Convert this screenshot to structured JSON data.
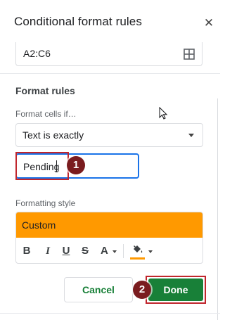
{
  "panel": {
    "title": "Conditional format rules",
    "close_icon": "close-icon",
    "range": "A2:C6",
    "range_icon": "select-range-grid-icon"
  },
  "format_rules": {
    "section_title": "Format rules",
    "format_cells_label": "Format cells if…",
    "condition": "Text is exactly",
    "value": "Pending"
  },
  "formatting_style": {
    "label": "Formatting style",
    "preset": "Custom",
    "fill_color": "#ff9900",
    "toolbar": {
      "bold": "B",
      "italic": "I",
      "underline": "U",
      "strikethrough": "S",
      "text_color": "A",
      "fill_icon": "fill-color-bucket-icon"
    }
  },
  "actions": {
    "cancel": "Cancel",
    "done": "Done"
  },
  "annotations": {
    "step_1": "1",
    "step_2": "2"
  },
  "colors": {
    "accent_blue": "#1a73e8",
    "done_green": "#188038",
    "highlight_red": "#c0262d",
    "badge": "#7a1c1f"
  }
}
